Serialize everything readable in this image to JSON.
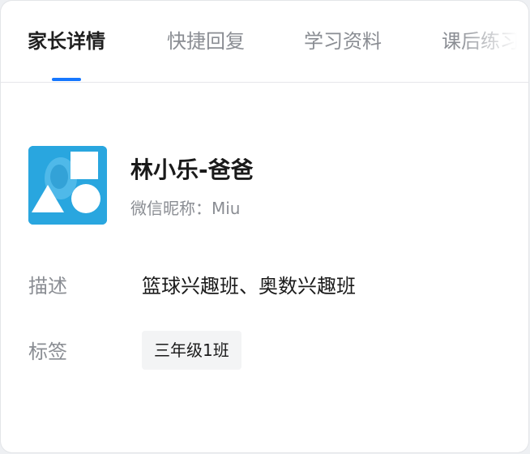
{
  "tabs": [
    {
      "label": "家长详情",
      "active": true
    },
    {
      "label": "快捷回复",
      "active": false
    },
    {
      "label": "学习资料",
      "active": false
    },
    {
      "label": "课后练习",
      "active": false
    }
  ],
  "accent_color": "#1677ff",
  "profile": {
    "avatar_icon": "avatar-shapes-icon",
    "name": "林小乐-爸爸",
    "nickname": "微信昵称：Miu"
  },
  "fields": {
    "description": {
      "label": "描述",
      "value": "篮球兴趣班、奥数兴趣班"
    },
    "tags": {
      "label": "标签",
      "items": [
        "三年级1班"
      ]
    }
  }
}
